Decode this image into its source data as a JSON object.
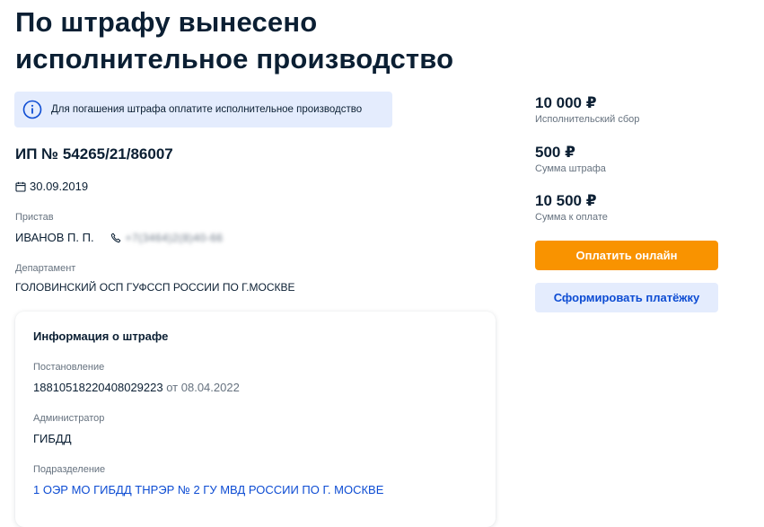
{
  "page_title": "По штрафу вынесено исполнительное производство",
  "info_banner": {
    "icon": "info-icon",
    "text": "Для погашения штрафа оплатите исполнительное производство"
  },
  "ip_number": "ИП № 54265/21/86007",
  "date": {
    "icon": "calendar-icon",
    "value": "30.09.2019"
  },
  "bailiff": {
    "label": "Пристав",
    "name": "ИВАНОВ П. П.",
    "phone_icon": "phone-icon",
    "phone": "+7(3464)2(8)40-66"
  },
  "department": {
    "label": "Департамент",
    "value": "ГОЛОВИНСКИЙ ОСП ГУФССП РОССИИ ПО Г.МОСКВЕ"
  },
  "fine_info": {
    "title": "Информация о штрафе",
    "decree_label": "Постановление",
    "decree_number": "18810518220408029223",
    "decree_date": "от 08.04.2022",
    "admin_label": "Администратор",
    "admin_value": "ГИБДД",
    "division_label": "Подразделение",
    "division_value": "1 ОЭР МО ГИБДД ТНРЭР № 2 ГУ МВД РОССИИ ПО Г. МОСКВЕ"
  },
  "summary": {
    "fee_amount": "10 000 ₽",
    "fee_label": "Исполнительский сбор",
    "fine_amount": "500 ₽",
    "fine_label": "Сумма штрафа",
    "total_amount": "10 500 ₽",
    "total_label": "Сумма к оплате"
  },
  "buttons": {
    "pay_online": "Оплатить онлайн",
    "form_payment": "Сформировать платёжку"
  },
  "colors": {
    "accent_orange": "#f99300",
    "accent_blue": "#0d4cd3",
    "banner_bg": "#e4ecfd",
    "text_dark": "#0b1f33",
    "text_muted": "#66727f"
  }
}
